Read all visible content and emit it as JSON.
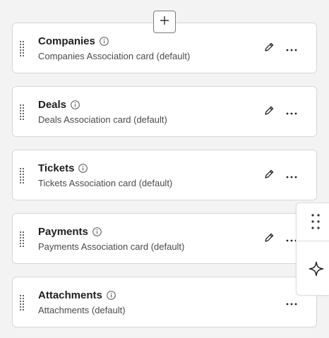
{
  "toolbar": {
    "add_icon": "plus-icon"
  },
  "cards": [
    {
      "title": "Companies",
      "subtitle": "Companies Association card (default)",
      "editable": true
    },
    {
      "title": "Deals",
      "subtitle": "Deals Association card (default)",
      "editable": true
    },
    {
      "title": "Tickets",
      "subtitle": "Tickets Association card (default)",
      "editable": true
    },
    {
      "title": "Payments",
      "subtitle": "Payments Association card (default)",
      "editable": true
    },
    {
      "title": "Attachments",
      "subtitle": "Attachments (default)",
      "editable": false
    }
  ],
  "side_panel": {
    "icons": [
      "drag-dots-icon",
      "sparkle-icon"
    ]
  },
  "colors": {
    "card_bg": "#ffffff",
    "page_bg": "#f3f3f3",
    "border": "#d6d6d6",
    "text": "#1f1f1f"
  }
}
